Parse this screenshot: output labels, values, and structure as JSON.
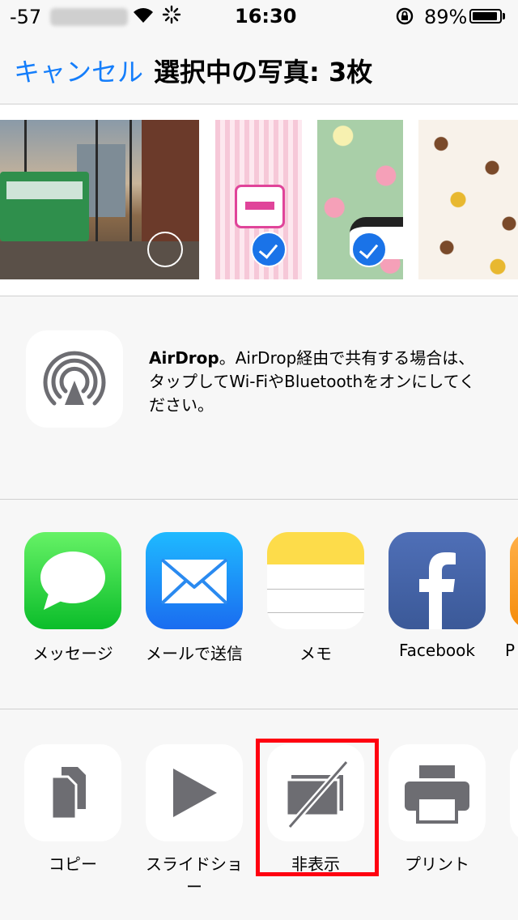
{
  "status_bar": {
    "signal": "-57",
    "time": "16:30",
    "battery": "89%"
  },
  "header": {
    "cancel": "キャンセル",
    "title": "選択中の写真: 3枚"
  },
  "photos": [
    {
      "selected": false
    },
    {
      "selected": true
    },
    {
      "selected": true
    },
    {
      "selected": false
    }
  ],
  "airdrop": {
    "title": "AirDrop",
    "text": "。AirDrop経由で共有する場合は、タップしてWi-FiやBluetoothをオンにしてください。"
  },
  "share_apps": [
    {
      "label": "メッセージ",
      "icon": "messages-icon"
    },
    {
      "label": "メールで送信",
      "icon": "mail-icon"
    },
    {
      "label": "メモ",
      "icon": "notes-icon"
    },
    {
      "label": "Facebook",
      "icon": "facebook-icon"
    },
    {
      "label": "P",
      "icon": "partial-app-icon"
    }
  ],
  "actions": [
    {
      "label": "コピー",
      "icon": "copy-icon"
    },
    {
      "label": "スライドショー",
      "icon": "slideshow-icon"
    },
    {
      "label": "非表示",
      "icon": "hide-icon"
    },
    {
      "label": "プリント",
      "icon": "print-icon"
    }
  ],
  "colors": {
    "accent": "#157efb",
    "highlight": "#ff0010",
    "check": "#1a73e8"
  }
}
